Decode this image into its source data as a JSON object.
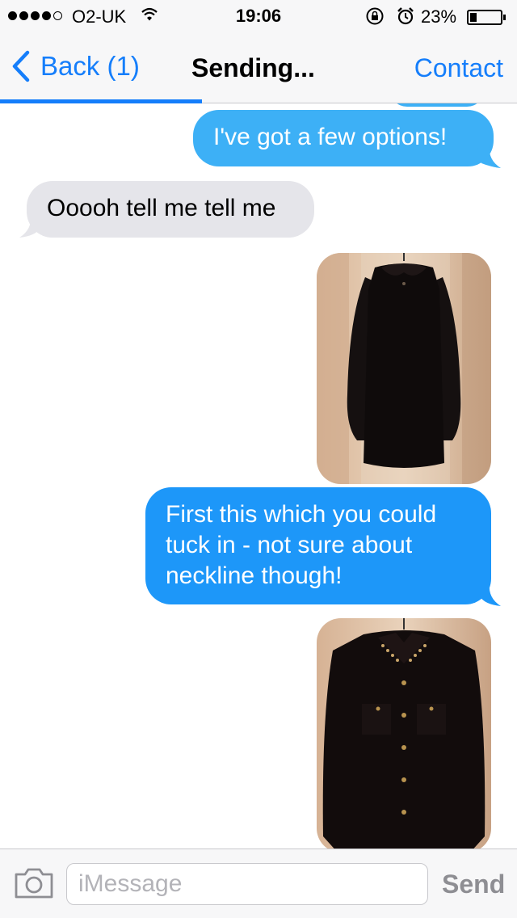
{
  "status_bar": {
    "signal_bars_filled": 4,
    "signal_bars_total": 5,
    "carrier": "O2-UK",
    "wifi_icon": "wifi-icon",
    "time": "19:06",
    "rotation_lock_icon": "rotation-lock-icon",
    "alarm_icon": "alarm-icon",
    "battery_percent": "23%",
    "battery_level": 0.23
  },
  "nav": {
    "back_label": "Back (1)",
    "title": "Sending...",
    "contact_label": "Contact",
    "send_progress": 0.39,
    "accent_color": "#157efb"
  },
  "messages": [
    {
      "type": "text",
      "direction": "outgoing",
      "text": "I've got a few options!"
    },
    {
      "type": "text",
      "direction": "incoming",
      "text": "Ooooh tell me tell me"
    },
    {
      "type": "image",
      "direction": "outgoing",
      "subject": "black chiffon long-sleeve dress with peter pan collar"
    },
    {
      "type": "text",
      "direction": "outgoing",
      "text": "First this which you could tuck in - not sure about neckline though!"
    },
    {
      "type": "image",
      "direction": "outgoing",
      "subject": "black sheer shirt with studded collar and gold buttons"
    }
  ],
  "composer": {
    "camera_icon": "camera-icon",
    "placeholder": "iMessage",
    "value": "",
    "send_label": "Send"
  },
  "colors": {
    "outgoing_bubble": "#1d97f9",
    "incoming_bubble": "#e5e5ea",
    "bars": "#f7f7f8"
  }
}
